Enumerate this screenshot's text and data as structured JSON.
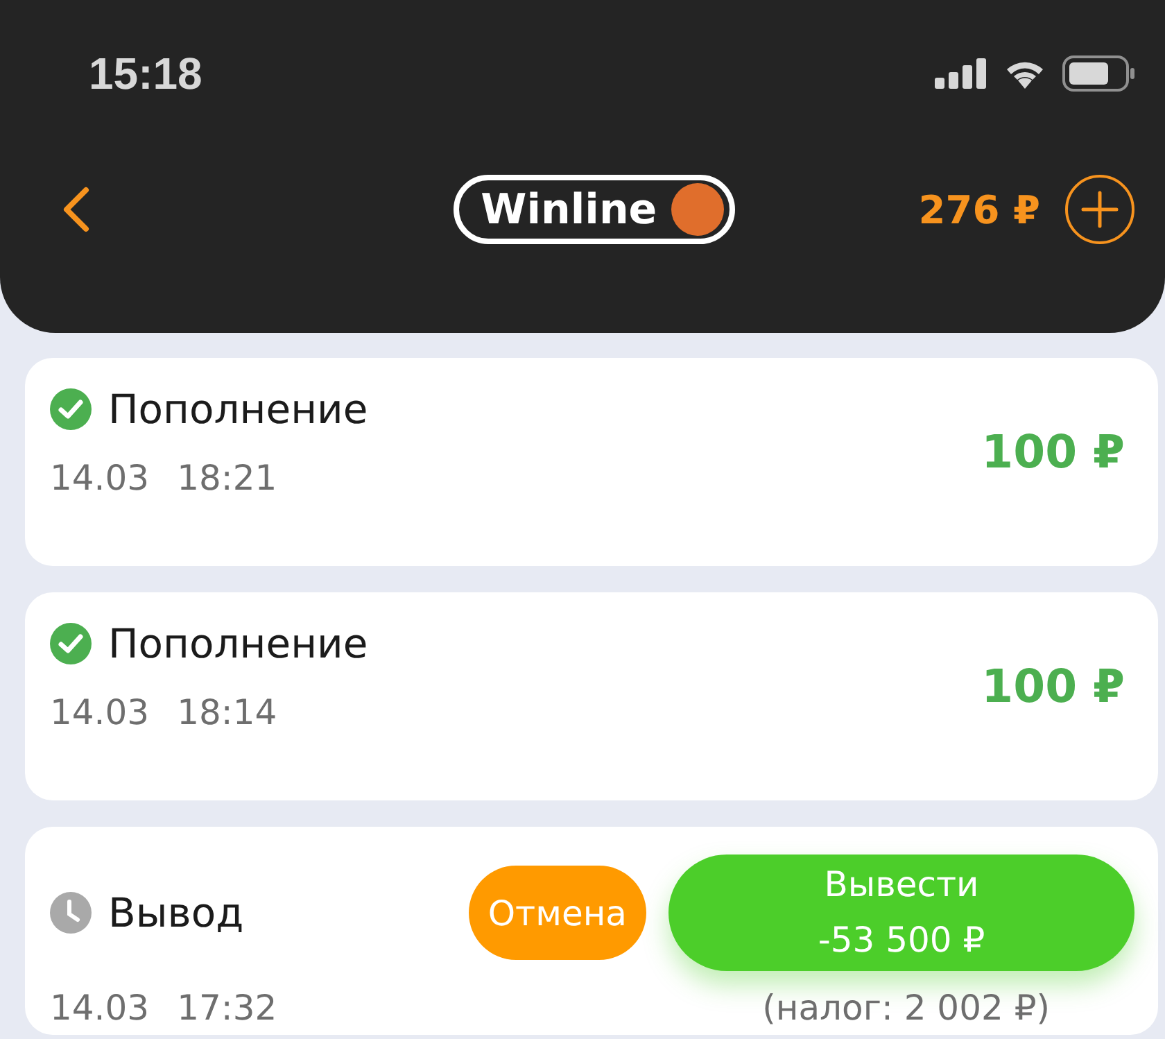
{
  "status_bar": {
    "time": "15:18"
  },
  "header": {
    "logo": "Winline",
    "balance": "276 ₽"
  },
  "transactions": [
    {
      "kind": "deposit",
      "completed": true,
      "title": "Пополнение",
      "date": "14.03",
      "time": "18:21",
      "amount": "100 ₽"
    },
    {
      "kind": "deposit",
      "completed": true,
      "title": "Пополнение",
      "date": "14.03",
      "time": "18:14",
      "amount": "100 ₽"
    },
    {
      "kind": "withdrawal",
      "completed": false,
      "title": "Вывод",
      "date": "14.03",
      "time": "17:32",
      "cancel_label": "Отмена",
      "withdraw_label": "Вывести",
      "amount": "-53 500 ₽",
      "tax": "(налог: 2 002 ₽)"
    }
  ]
}
